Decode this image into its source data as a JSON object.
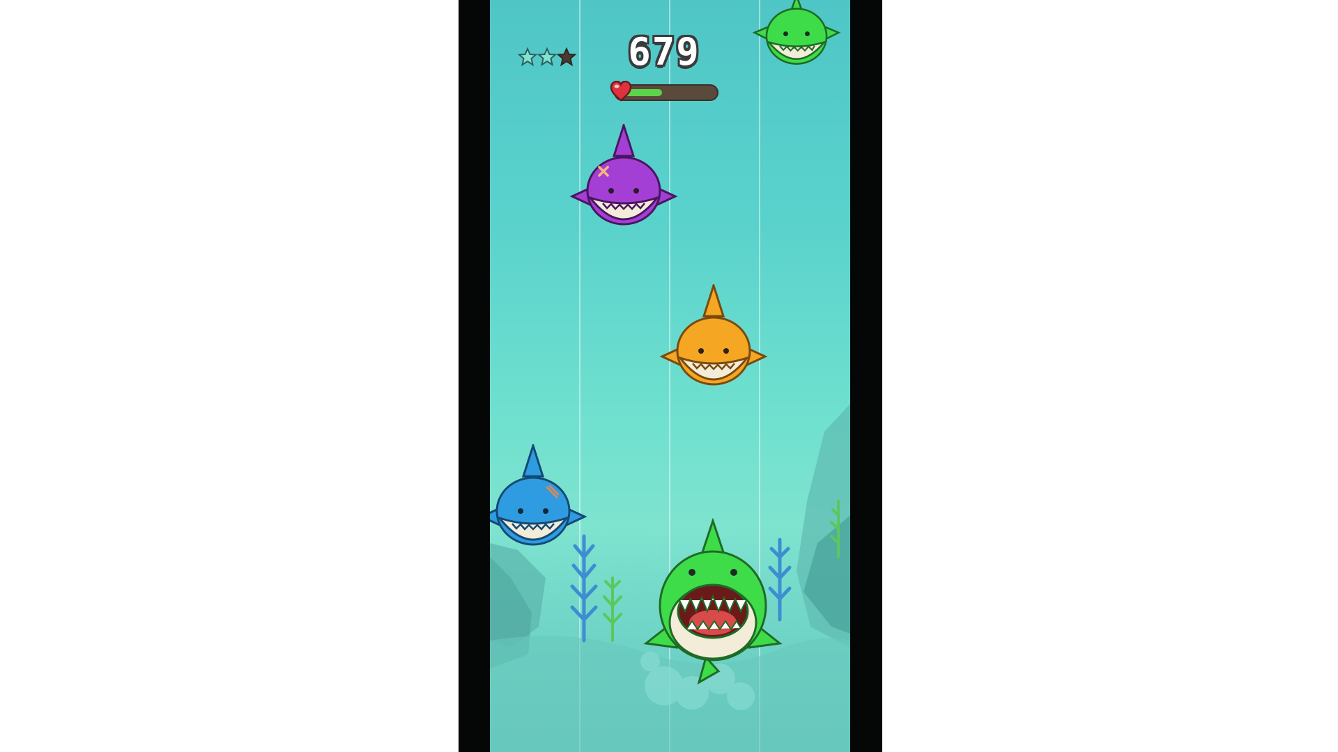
{
  "game": {
    "score": "679",
    "health": 0.45,
    "stars": {
      "earned": 2,
      "total": 3
    },
    "colors": {
      "water_top": "#4fc6c6",
      "water_bottom": "#64c7bf",
      "health_fill": "#5cd34a",
      "health_track": "#5a4a3c",
      "star_earned": "#7fe3d3",
      "star_empty": "#4a3a30"
    },
    "sharks": [
      {
        "role": "enemy",
        "color": "#3fdc4a",
        "icon": "green-shark-icon"
      },
      {
        "role": "enemy",
        "color": "#a43fd6",
        "icon": "purple-shark-icon"
      },
      {
        "role": "enemy",
        "color": "#f5a623",
        "icon": "orange-shark-icon"
      },
      {
        "role": "enemy",
        "color": "#2f9be0",
        "icon": "blue-shark-icon"
      },
      {
        "role": "player",
        "color": "#3fdc4a",
        "icon": "player-shark-icon"
      }
    ]
  }
}
